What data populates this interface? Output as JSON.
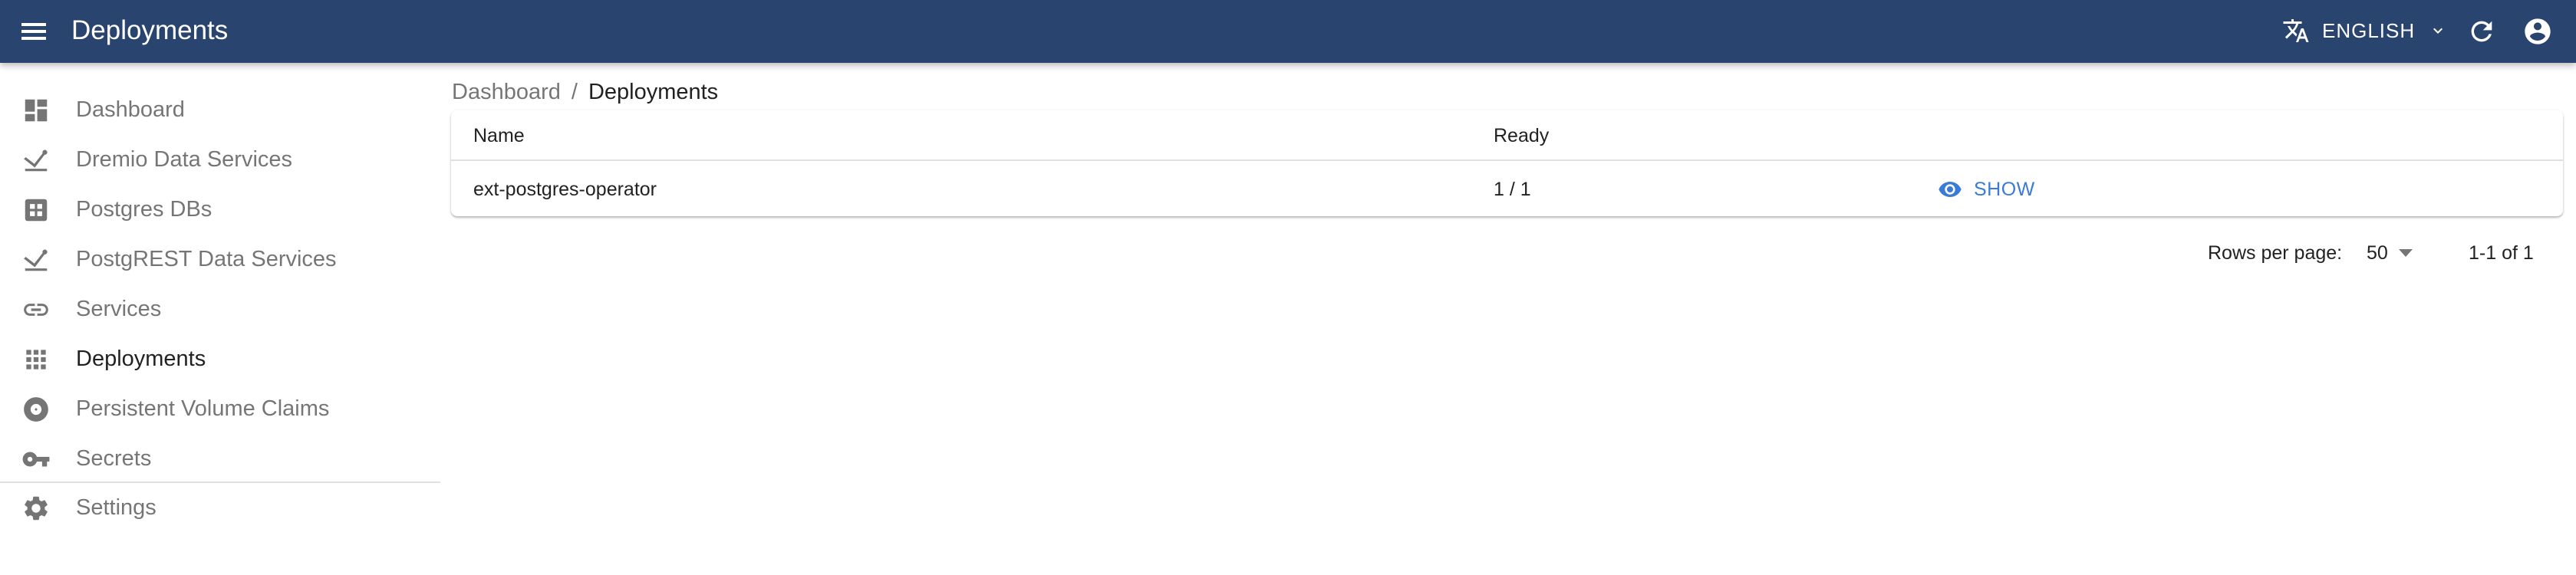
{
  "appbar": {
    "title": "Deployments",
    "language": "ENGLISH",
    "color": "#2a4470"
  },
  "sidebar": {
    "items": [
      {
        "label": "Dashboard",
        "icon": "dashboard-icon"
      },
      {
        "label": "Dremio Data Services",
        "icon": "data-service-icon"
      },
      {
        "label": "Postgres DBs",
        "icon": "database-grid-icon"
      },
      {
        "label": "PostgREST Data Services",
        "icon": "data-service-icon"
      },
      {
        "label": "Services",
        "icon": "link-icon"
      },
      {
        "label": "Deployments",
        "icon": "apps-grid-icon",
        "active": true
      },
      {
        "label": "Persistent Volume Claims",
        "icon": "disc-icon"
      },
      {
        "label": "Secrets",
        "icon": "key-icon"
      },
      {
        "label": "Settings",
        "icon": "gear-icon"
      }
    ]
  },
  "breadcrumb": {
    "items": [
      "Dashboard",
      "Deployments"
    ],
    "separator": "/"
  },
  "table": {
    "columns": [
      "Name",
      "Ready"
    ],
    "rows": [
      {
        "name": "ext-postgres-operator",
        "ready": "1 / 1",
        "action": "SHOW"
      }
    ]
  },
  "pagination": {
    "rows_per_page_label": "Rows per page:",
    "rows_per_page": "50",
    "range": "1-1 of 1"
  },
  "colors": {
    "primary": "#3a7bd5",
    "icon_gray": "#757575"
  }
}
